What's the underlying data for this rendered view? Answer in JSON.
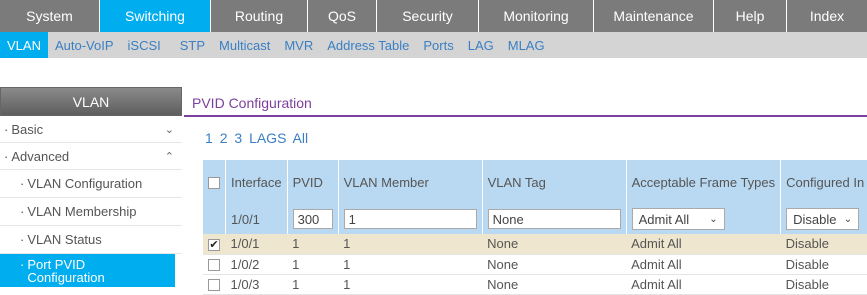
{
  "topnav": [
    "System",
    "Switching",
    "Routing",
    "QoS",
    "Security",
    "Monitoring",
    "Maintenance",
    "Help",
    "Index"
  ],
  "subnav": [
    "VLAN",
    "Auto-VoIP",
    "iSCSI",
    "STP",
    "Multicast",
    "MVR",
    "Address Table",
    "Ports",
    "LAG",
    "MLAG"
  ],
  "sidebar": {
    "title": "VLAN",
    "basic": "Basic",
    "advanced": "Advanced",
    "items": [
      "VLAN Configuration",
      "VLAN Membership",
      "VLAN Status"
    ],
    "active_line1": "Port PVID",
    "active_line2": "Configuration"
  },
  "main": {
    "tab": "PVID Configuration",
    "pages": [
      "1",
      "2",
      "3",
      "LAGS",
      "All"
    ]
  },
  "table": {
    "headers": [
      "Interface",
      "PVID",
      "VLAN Member",
      "VLAN Tag",
      "Acceptable Frame Types",
      "Configured In"
    ],
    "edit": {
      "interface": "1/0/1",
      "pvid": "300",
      "member": "1",
      "tag": "None",
      "frame": "Admit All",
      "configured": "Disable"
    },
    "rows": [
      {
        "iface": "1/0/1",
        "pvid": "1",
        "member": "1",
        "tag": "None",
        "frame": "Admit All",
        "configured": "Disable",
        "checked": true
      },
      {
        "iface": "1/0/2",
        "pvid": "1",
        "member": "1",
        "tag": "None",
        "frame": "Admit All",
        "configured": "Disable",
        "checked": false
      },
      {
        "iface": "1/0/3",
        "pvid": "1",
        "member": "1",
        "tag": "None",
        "frame": "Admit All",
        "configured": "Disable",
        "checked": false
      }
    ]
  },
  "colors": {
    "accent": "#00aeef",
    "nav": "#7b7b7b",
    "purple": "#7b3f9e",
    "table_header": "#b9d9f2",
    "selected_row": "#efe6cf"
  }
}
